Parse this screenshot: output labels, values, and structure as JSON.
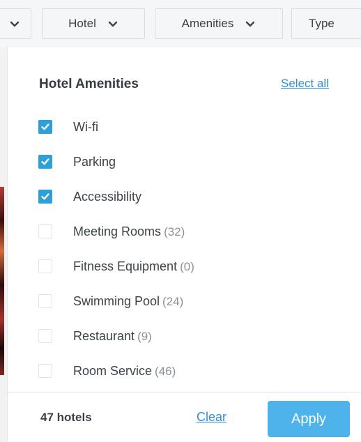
{
  "filters": [
    {
      "label": "",
      "icon": "chevron-down-icon"
    },
    {
      "label": "Hotel",
      "icon": "chevron-down-icon"
    },
    {
      "label": "Amenities",
      "icon": "chevron-down-icon"
    },
    {
      "label": "Type",
      "icon": ""
    }
  ],
  "panel": {
    "title": "Hotel Amenities",
    "select_all": "Select all",
    "options": [
      {
        "label": "Wi-fi",
        "count": "",
        "checked": true
      },
      {
        "label": "Parking",
        "count": "",
        "checked": true
      },
      {
        "label": "Accessibility",
        "count": "",
        "checked": true
      },
      {
        "label": "Meeting Rooms",
        "count": "(32)",
        "checked": false
      },
      {
        "label": "Fitness Equipment",
        "count": "(0)",
        "checked": false
      },
      {
        "label": "Swimming Pool",
        "count": "(24)",
        "checked": false
      },
      {
        "label": "Restaurant",
        "count": "(9)",
        "checked": false
      },
      {
        "label": "Room Service",
        "count": "(46)",
        "checked": false
      }
    ]
  },
  "footer": {
    "hotel_count": "47 hotels",
    "clear": "Clear",
    "apply": "Apply"
  },
  "colors": {
    "accent": "#2f9fd8",
    "link": "#2f8fd6",
    "apply_button": "#4eb3ea"
  }
}
